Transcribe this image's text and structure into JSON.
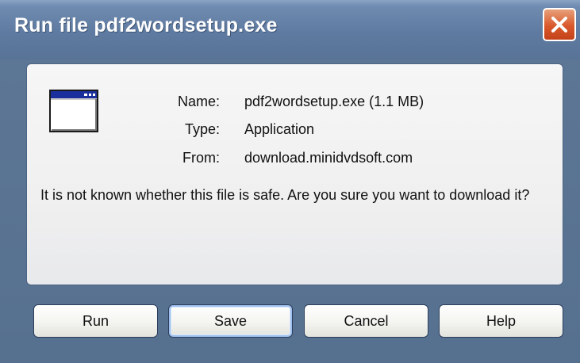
{
  "window": {
    "title": "Run file pdf2wordsetup.exe"
  },
  "file_info": {
    "name_label": "Name:",
    "name_value": "pdf2wordsetup.exe (1.1 MB)",
    "type_label": "Type:",
    "type_value": "Application",
    "from_label": "From:",
    "from_value": "download.minidvdsoft.com"
  },
  "warning_text": "It is not known whether this file is safe. Are you sure you want to download it?",
  "buttons": {
    "run": "Run",
    "save": "Save",
    "cancel": "Cancel",
    "help": "Help"
  },
  "icons": {
    "close": "close-icon",
    "file": "application-window-icon"
  },
  "colors": {
    "titlebar": "#6f8bb0",
    "close_button": "#d9582b",
    "panel_bg": "#f0f0f0",
    "default_button_focus": "#9fc0ef"
  }
}
